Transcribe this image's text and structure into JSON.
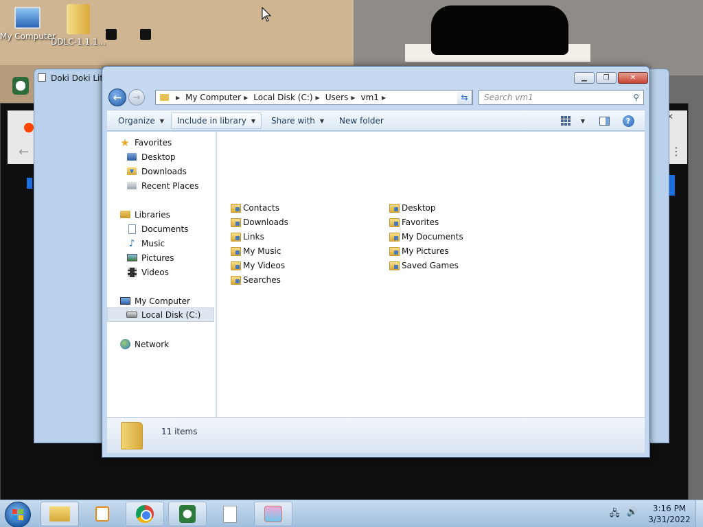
{
  "desktop": {
    "icons": [
      {
        "label": "My Computer"
      },
      {
        "label": "DDLC-1.1.1..."
      }
    ]
  },
  "background_window": {
    "title": "Doki Doki Liter"
  },
  "explorer": {
    "address": {
      "crumbs": [
        "My Computer",
        "Local Disk (C:)",
        "Users",
        "vm1"
      ]
    },
    "search": {
      "placeholder": "Search vm1"
    },
    "toolbar": {
      "organize": "Organize",
      "include_in_library": "Include in library",
      "share_with": "Share with",
      "new_folder": "New folder"
    },
    "nav": {
      "favorites": "Favorites",
      "desktop": "Desktop",
      "downloads": "Downloads",
      "recent_places": "Recent Places",
      "libraries": "Libraries",
      "documents": "Documents",
      "music": "Music",
      "pictures": "Pictures",
      "videos": "Videos",
      "my_computer": "My Computer",
      "local_disk": "Local Disk (C:)",
      "network": "Network"
    },
    "files": [
      "Contacts",
      "Downloads",
      "Links",
      "My Music",
      "My Videos",
      "Searches",
      "Desktop",
      "Favorites",
      "My Documents",
      "My Pictures",
      "Saved Games"
    ],
    "status": {
      "count": "11 items"
    }
  },
  "taskbar": {
    "clock": {
      "time": "3:16 PM",
      "date": "3/31/2022"
    }
  },
  "colors": {
    "window_frame": "#c4d9ef",
    "selection": "#dde6ef",
    "close_button": "#c74434",
    "taskbar": "#b5cfe8"
  }
}
